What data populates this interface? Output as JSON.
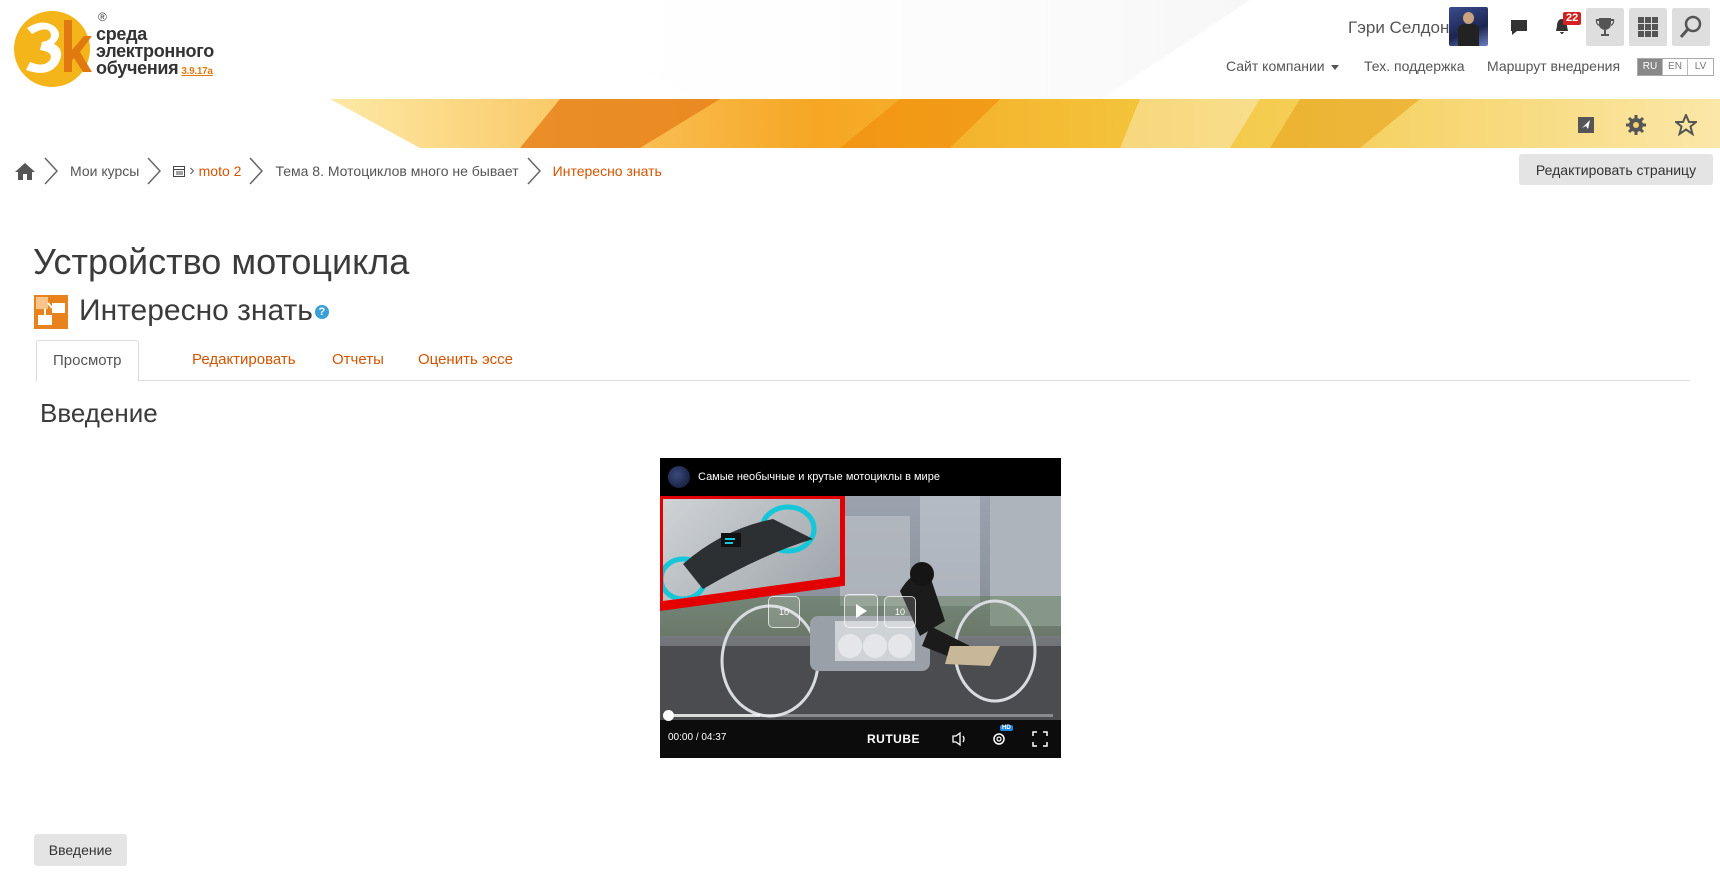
{
  "logo": {
    "line1": "среда",
    "line2": "электронного",
    "line3": "обучения",
    "version": "3.9.17a",
    "registered": "®",
    "mark": "3k"
  },
  "header": {
    "user_name": "Гэри Селдон",
    "notifications_count": "22",
    "nav": {
      "company_site": "Сайт компании",
      "support": "Тех. поддержка",
      "route": "Маршрут внедрения"
    },
    "languages": [
      "RU",
      "EN",
      "LV"
    ],
    "active_language": "RU",
    "icons": {
      "messages": "chat-icon",
      "notifications": "bell-icon",
      "achievements": "trophy-icon",
      "apps": "grid-icon",
      "search": "search-icon",
      "navigate": "location-arrow-icon",
      "settings": "gear-icon",
      "favorites": "star-icon"
    }
  },
  "breadcrumb": {
    "home_icon": "home-icon",
    "items": [
      "Мои курсы",
      "moto 2",
      "Тема 8. Мотоциклов много не бывает",
      "Интересно знать"
    ],
    "edit_page_label": "Редактировать страницу"
  },
  "main": {
    "course_title": "Устройство мотоцикла",
    "activity_title": "Интересно знать",
    "help_glyph": "?",
    "tabs": [
      {
        "label": "Просмотр",
        "active": true
      },
      {
        "label": "Редактировать",
        "active": false
      },
      {
        "label": "Отчеты",
        "active": false
      },
      {
        "label": "Оценить эссе",
        "active": false
      }
    ],
    "section_title": "Введение",
    "video": {
      "title": "Самые необычные и крутые мотоциклы в мире",
      "current_time": "00:00",
      "separator": "/",
      "duration": "04:37",
      "provider": "RUTUBE",
      "hd_badge": "HD",
      "rewind_label": "10",
      "forward_label": "10",
      "progress_buffered": 0.24
    },
    "bottom_button": "Введение"
  },
  "colors": {
    "accent": "#d35400",
    "header_gradient": "#f5a623",
    "help": "#3aa0d8",
    "badge": "#d32020"
  }
}
